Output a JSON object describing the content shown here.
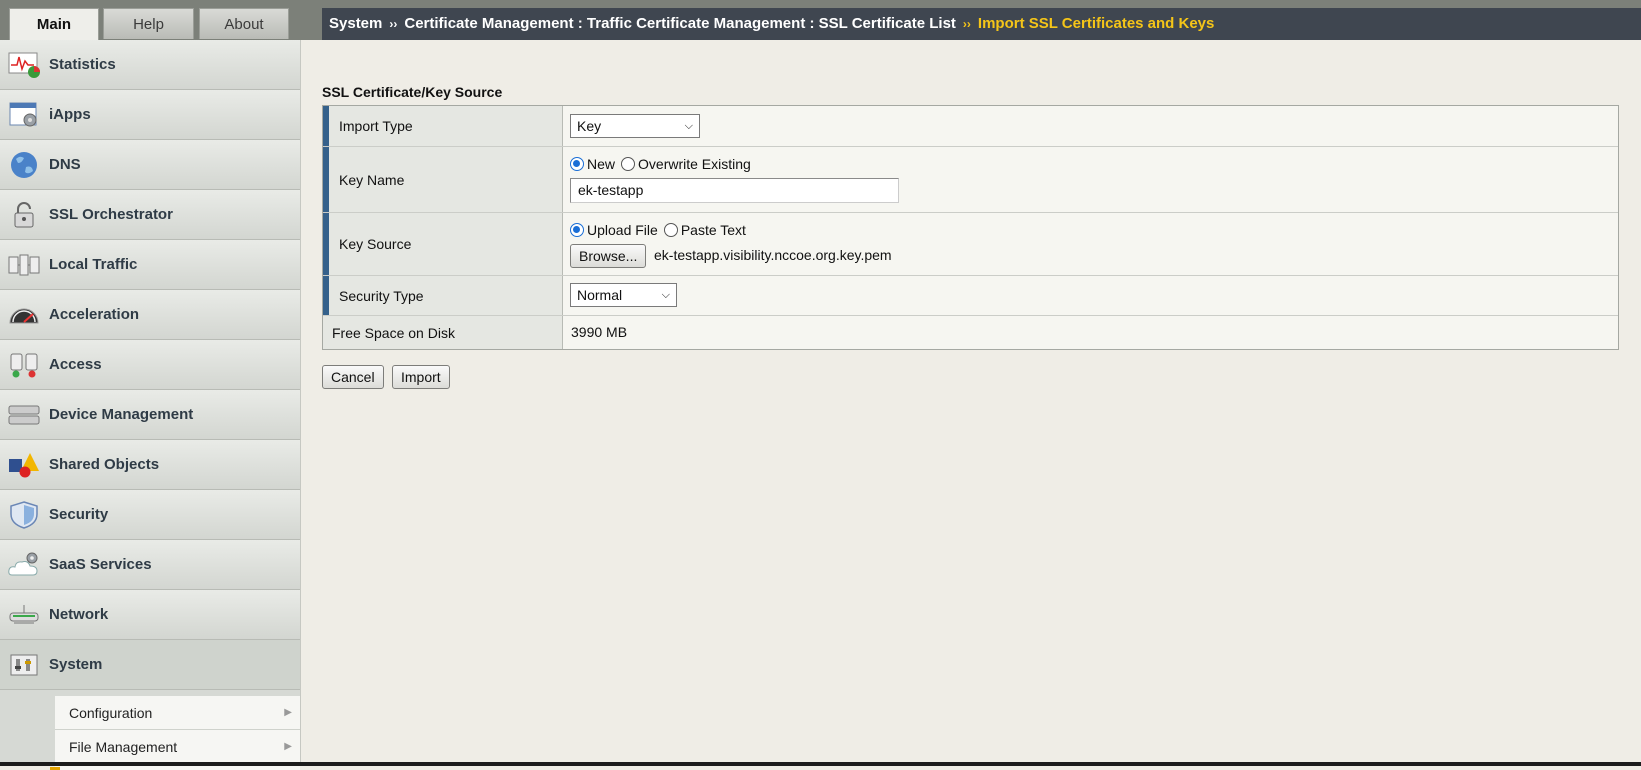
{
  "tabs": [
    "Main",
    "Help",
    "About"
  ],
  "nav": [
    {
      "label": "Statistics",
      "icon": "statistics-icon"
    },
    {
      "label": "iApps",
      "icon": "iapps-icon"
    },
    {
      "label": "DNS",
      "icon": "dns-globe-icon"
    },
    {
      "label": "SSL Orchestrator",
      "icon": "padlock-icon"
    },
    {
      "label": "Local Traffic",
      "icon": "local-traffic-icon"
    },
    {
      "label": "Acceleration",
      "icon": "speedometer-icon"
    },
    {
      "label": "Access",
      "icon": "access-icon"
    },
    {
      "label": "Device Management",
      "icon": "device-management-icon"
    },
    {
      "label": "Shared Objects",
      "icon": "shared-objects-icon"
    },
    {
      "label": "Security",
      "icon": "shield-icon"
    },
    {
      "label": "SaaS Services",
      "icon": "cloud-gear-icon"
    },
    {
      "label": "Network",
      "icon": "network-icon"
    },
    {
      "label": "System",
      "icon": "system-icon"
    }
  ],
  "system_submenu": [
    "Configuration",
    "File Management"
  ],
  "breadcrumb": {
    "root": "System",
    "path": "Certificate Management : Traffic Certificate Management : SSL Certificate List",
    "current": "Import SSL Certificates and Keys",
    "separator": "››"
  },
  "form": {
    "section_title": "SSL Certificate/Key Source",
    "import_type": {
      "label": "Import Type",
      "value": "Key"
    },
    "key_name": {
      "label": "Key Name",
      "option_new": "New",
      "option_overwrite": "Overwrite Existing",
      "selected": "New",
      "value": "ek-testapp"
    },
    "key_source": {
      "label": "Key Source",
      "option_upload": "Upload File",
      "option_paste": "Paste Text",
      "selected": "Upload File",
      "browse_label": "Browse...",
      "file_name": "ek-testapp.visibility.nccoe.org.key.pem"
    },
    "security_type": {
      "label": "Security Type",
      "value": "Normal"
    },
    "free_space": {
      "label": "Free Space on Disk",
      "value": "3990 MB"
    }
  },
  "buttons": {
    "cancel": "Cancel",
    "import": "Import"
  },
  "colors": {
    "breadcrumb_bg": "#3f4650",
    "breadcrumb_current": "#f5c518",
    "row_marker": "#35618b",
    "radio_selected": "#1a6ed6"
  }
}
